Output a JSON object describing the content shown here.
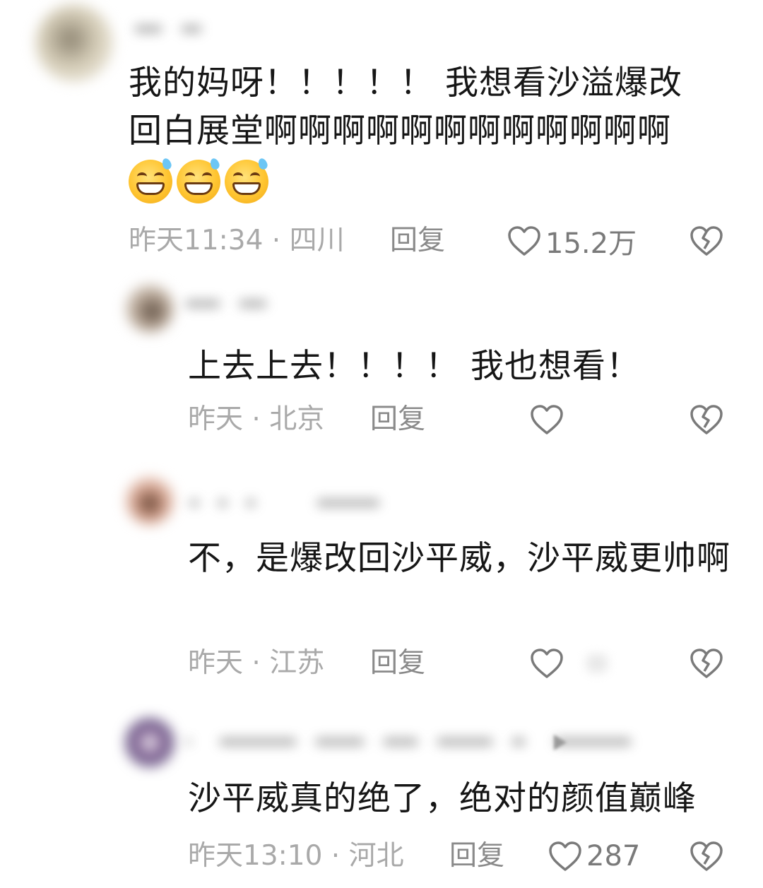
{
  "comments": [
    {
      "text_line1": "我的妈呀！！！！！ 我想看沙溢爆改",
      "text_line2": "回白展堂啊啊啊啊啊啊啊啊啊啊啊啊",
      "emojis": [
        "sweat-grin-emoji",
        "sweat-grin-emoji",
        "sweat-grin-emoji"
      ],
      "meta": "昨天11:34 · 四川",
      "reply_label": "回复",
      "like_count": "15.2万",
      "avatar_color": "#c9c2b0"
    },
    {
      "text": "上去上去！！！！ 我也想看！",
      "meta": "昨天 · 北京",
      "reply_label": "回复",
      "like_count": "",
      "avatar_color": "#a99a8a"
    },
    {
      "text": "不，是爆改回沙平威，沙平威更帅啊",
      "meta": "昨天 · 江苏",
      "reply_label": "回复",
      "like_count": "",
      "avatar_color": "#c89b86"
    },
    {
      "text": "沙平威真的绝了，绝对的颜值巅峰",
      "meta": "昨天13:10 · 河北",
      "reply_label": "回复",
      "like_count": "287",
      "avatar_color": "#6b5a8a"
    }
  ],
  "colors": {
    "text": "#161616",
    "meta": "#a9a9a9",
    "icon": "#7a7a7a"
  }
}
